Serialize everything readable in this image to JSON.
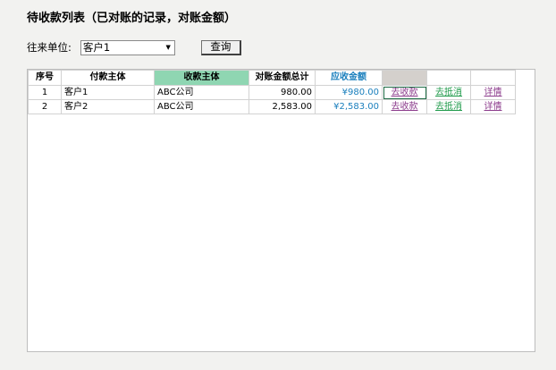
{
  "page": {
    "title": "待收款列表（已对账的记录，对账金额）"
  },
  "filter": {
    "label": "往来单位:",
    "selected": "客户1",
    "query_label": "查询"
  },
  "table": {
    "columns": [
      "序号",
      "付款主体",
      "收款主体",
      "对账金额总计",
      "应收金额",
      "",
      "",
      ""
    ],
    "rows": [
      {
        "index": "1",
        "payer": "客户1",
        "payee": "ABC公司",
        "total": "980.00",
        "receivable": "¥980.00",
        "collect": "去收款",
        "offset": "去抵消",
        "detail": "详情"
      },
      {
        "index": "2",
        "payer": "客户2",
        "payee": "ABC公司",
        "total": "2,583.00",
        "receivable": "¥2,583.00",
        "collect": "去收款",
        "offset": "去抵消",
        "detail": "详情"
      }
    ]
  },
  "colors": {
    "header_green": "#8fd6b2",
    "header_gray": "#d4d0cc",
    "amount_blue": "#1a7fbd",
    "link_purple": "#8b3a8b",
    "link_green": "#1e9a4a"
  }
}
